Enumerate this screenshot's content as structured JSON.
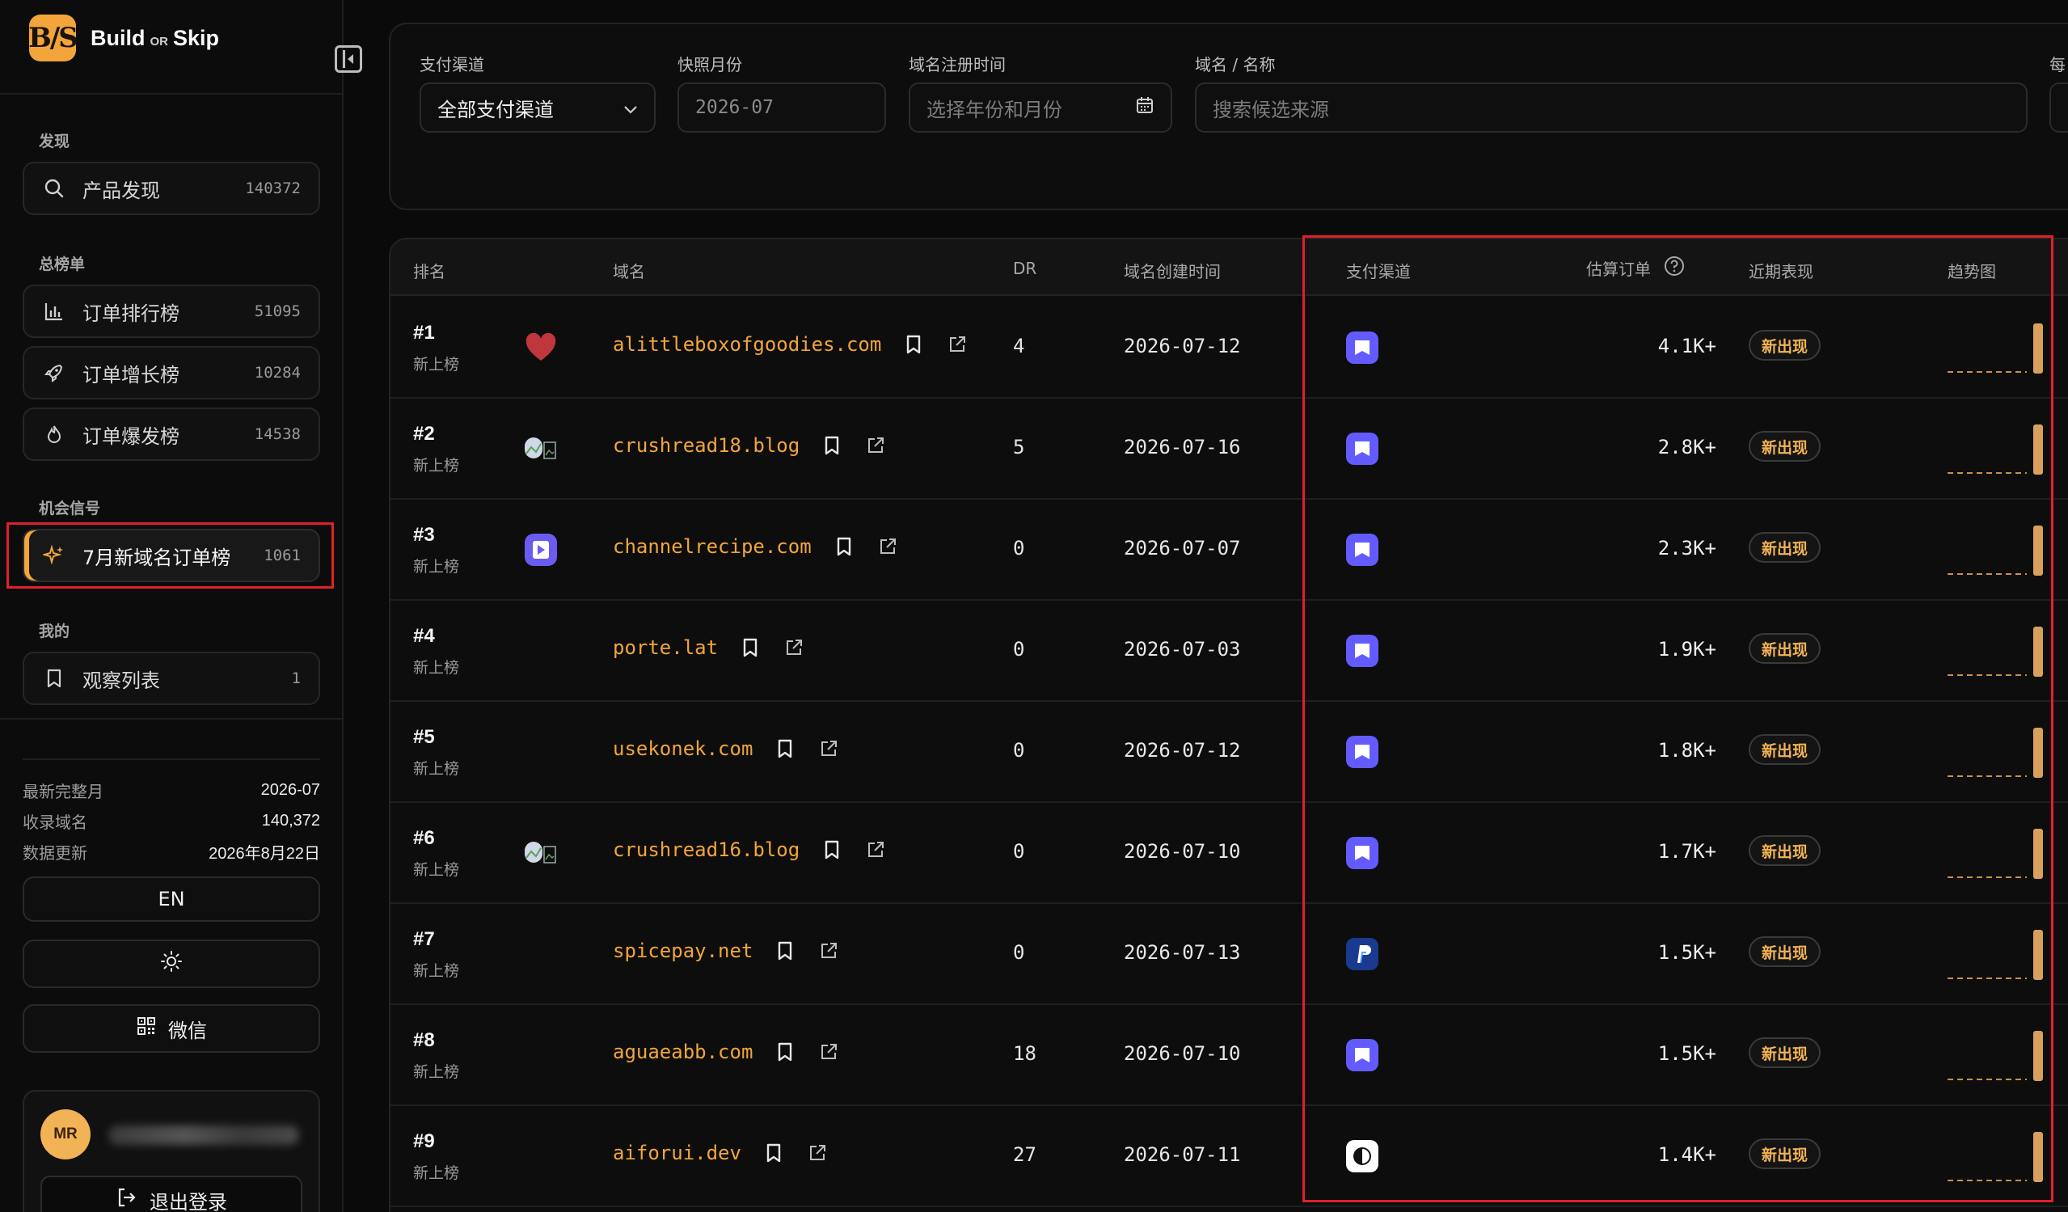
{
  "brand": {
    "logo_text": "B/S",
    "name_part1": "Build",
    "name_or": "OR",
    "name_part2": "Skip"
  },
  "sidebar": {
    "sections": {
      "discover": "发现",
      "leaderboards": "总榜单",
      "signals": "机会信号",
      "mine": "我的"
    },
    "items": [
      {
        "label": "产品发现",
        "count": "140372",
        "icon": "search-icon"
      },
      {
        "label": "订单排行榜",
        "count": "51095",
        "icon": "bar-chart-icon"
      },
      {
        "label": "订单增长榜",
        "count": "10284",
        "icon": "rocket-icon"
      },
      {
        "label": "订单爆发榜",
        "count": "14538",
        "icon": "flame-icon"
      },
      {
        "label": "7月新域名订单榜",
        "count": "1061",
        "icon": "sparkle-icon",
        "active": true
      },
      {
        "label": "观察列表",
        "count": "1",
        "icon": "bookmark-icon"
      }
    ],
    "stats": [
      {
        "key": "最新完整月",
        "value": "2026-07"
      },
      {
        "key": "收录域名",
        "value": "140,372"
      },
      {
        "key": "数据更新",
        "value": "2026年8月22日"
      }
    ],
    "lang_button": "EN",
    "wechat_button": "微信",
    "user": {
      "initials": "MR",
      "logout": "退出登录"
    }
  },
  "filters": {
    "payment": {
      "label": "支付渠道",
      "value": "全部支付渠道"
    },
    "snapshot": {
      "label": "快照月份",
      "value": "2026-07"
    },
    "registered": {
      "label": "域名注册时间",
      "placeholder": "选择年份和月份"
    },
    "search": {
      "label": "域名 / 名称",
      "placeholder": "搜索候选来源"
    },
    "extra_label": "每"
  },
  "table": {
    "headers": {
      "rank": "排名",
      "domain": "域名",
      "dr": "DR",
      "created": "域名创建时间",
      "payment": "支付渠道",
      "orders": "估算订单",
      "recent": "近期表现",
      "trend": "趋势图"
    },
    "rows": [
      {
        "rank": "#1",
        "sub": "新上榜",
        "favicon": "heart",
        "domain": "alittleboxofgoodies.com",
        "dr": "4",
        "created": "2026-07-12",
        "pay": "stripe",
        "orders": "4.1K+",
        "badge": "新出现"
      },
      {
        "rank": "#2",
        "sub": "新上榜",
        "favicon": "broken",
        "domain": "crushread18.blog",
        "dr": "5",
        "created": "2026-07-16",
        "pay": "stripe",
        "orders": "2.8K+",
        "badge": "新出现"
      },
      {
        "rank": "#3",
        "sub": "新上榜",
        "favicon": "play",
        "domain": "channelrecipe.com",
        "dr": "0",
        "created": "2026-07-07",
        "pay": "stripe",
        "orders": "2.3K+",
        "badge": "新出现"
      },
      {
        "rank": "#4",
        "sub": "新上榜",
        "favicon": "none",
        "domain": "porte.lat",
        "dr": "0",
        "created": "2026-07-03",
        "pay": "stripe",
        "orders": "1.9K+",
        "badge": "新出现"
      },
      {
        "rank": "#5",
        "sub": "新上榜",
        "favicon": "none",
        "domain": "usekonek.com",
        "dr": "0",
        "created": "2026-07-12",
        "pay": "stripe",
        "orders": "1.8K+",
        "badge": "新出现"
      },
      {
        "rank": "#6",
        "sub": "新上榜",
        "favicon": "broken",
        "domain": "crushread16.blog",
        "dr": "0",
        "created": "2026-07-10",
        "pay": "stripe",
        "orders": "1.7K+",
        "badge": "新出现"
      },
      {
        "rank": "#7",
        "sub": "新上榜",
        "favicon": "none",
        "domain": "spicepay.net",
        "dr": "0",
        "created": "2026-07-13",
        "pay": "paypal",
        "orders": "1.5K+",
        "badge": "新出现"
      },
      {
        "rank": "#8",
        "sub": "新上榜",
        "favicon": "none",
        "domain": "aguaeabb.com",
        "dr": "18",
        "created": "2026-07-10",
        "pay": "stripe",
        "orders": "1.5K+",
        "badge": "新出现"
      },
      {
        "rank": "#9",
        "sub": "新上榜",
        "favicon": "none",
        "domain": "aiforui.dev",
        "dr": "27",
        "created": "2026-07-11",
        "pay": "creem",
        "orders": "1.4K+",
        "badge": "新出现"
      }
    ]
  },
  "colors": {
    "accent": "#f2a53b",
    "stripe": "#635bff",
    "paypal": "#1a3a8f",
    "highlight": "#e0202a"
  }
}
